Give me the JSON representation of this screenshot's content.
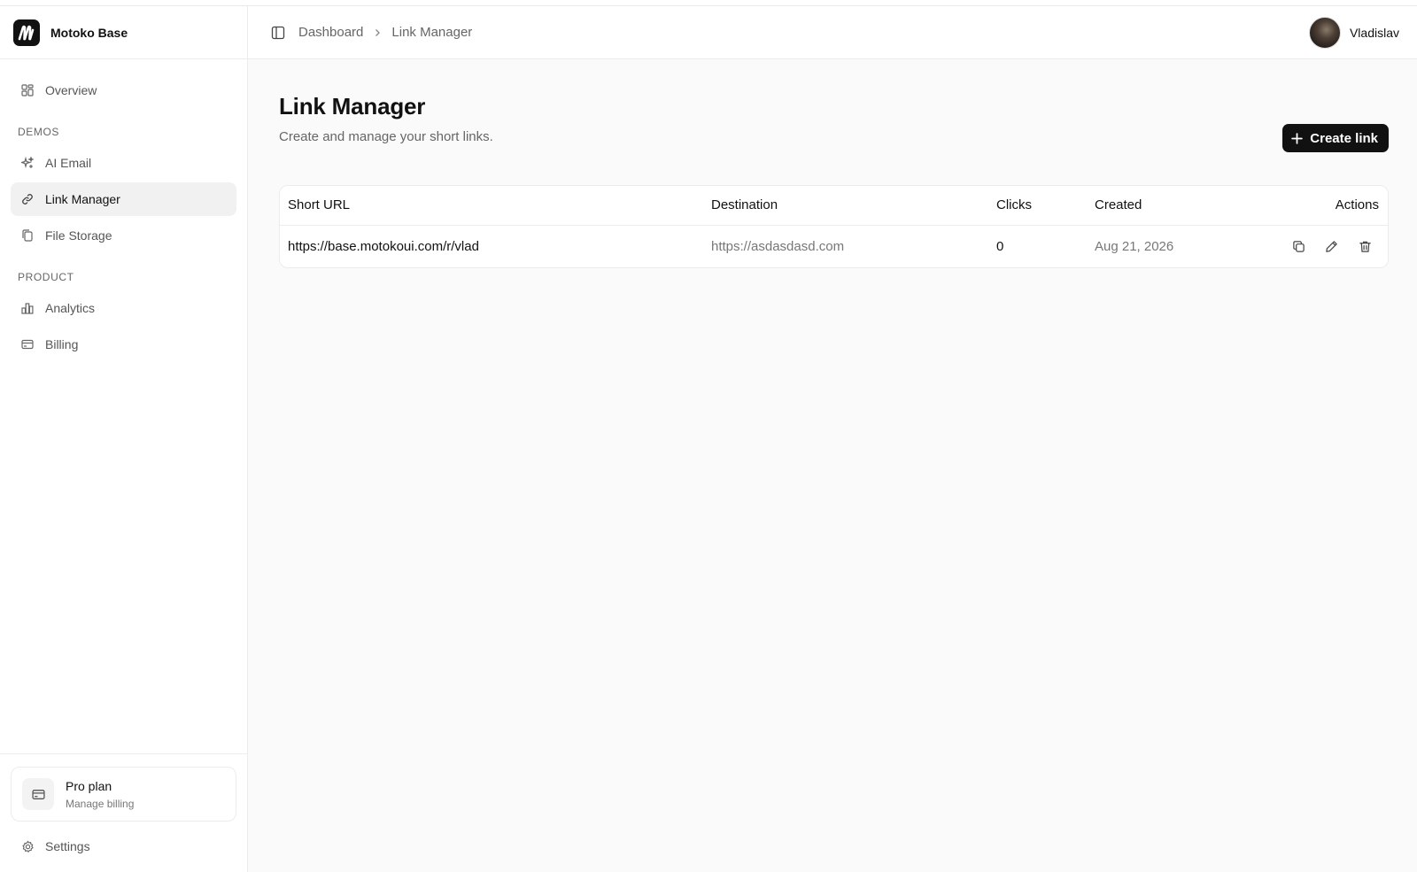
{
  "brand": {
    "name": "Motoko Base"
  },
  "sidebar": {
    "items": [
      {
        "label": "Overview",
        "icon": "grid-icon"
      }
    ],
    "sections": [
      {
        "title": "DEMOS",
        "items": [
          {
            "label": "AI Email",
            "icon": "sparkles-icon"
          },
          {
            "label": "Link Manager",
            "icon": "link-icon",
            "active": true
          },
          {
            "label": "File Storage",
            "icon": "files-icon"
          }
        ]
      },
      {
        "title": "PRODUCT",
        "items": [
          {
            "label": "Analytics",
            "icon": "bar-chart-icon"
          },
          {
            "label": "Billing",
            "icon": "credit-card-icon"
          }
        ]
      }
    ],
    "plan": {
      "title": "Pro plan",
      "subtitle": "Manage billing"
    },
    "settings_label": "Settings"
  },
  "header": {
    "breadcrumb": [
      "Dashboard",
      "Link Manager"
    ],
    "user_name": "Vladislav"
  },
  "page": {
    "title": "Link Manager",
    "subtitle": "Create and manage your short links.",
    "create_label": "Create link"
  },
  "table": {
    "columns": [
      "Short URL",
      "Destination",
      "Clicks",
      "Created",
      "Actions"
    ],
    "rows": [
      {
        "short_url": "https://base.motokoui.com/r/vlad",
        "destination": "https://asdasdasd.com",
        "clicks": "0",
        "created": "Aug 21, 2026"
      }
    ]
  },
  "colors": {
    "accent": "#111111",
    "muted": "#777777",
    "background": "#fafafa"
  }
}
